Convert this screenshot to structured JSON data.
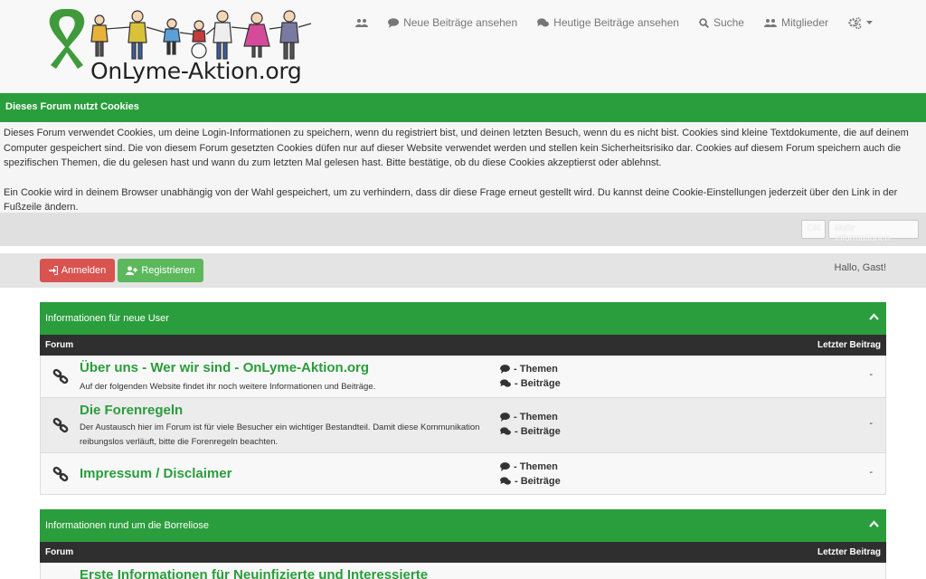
{
  "header": {
    "logo_text": "OnLyme-Aktion.org",
    "nav": [
      {
        "label": "",
        "icon": "users-icon"
      },
      {
        "label": "Neue Beiträge ansehen",
        "icon": "comment-icon"
      },
      {
        "label": "Heutige Beiträge ansehen",
        "icon": "comments-icon"
      },
      {
        "label": "Suche",
        "icon": "search-icon"
      },
      {
        "label": "Mitglieder",
        "icon": "users-icon"
      },
      {
        "label": "",
        "icon": "cogs-icon"
      }
    ]
  },
  "cookie": {
    "title": "Dieses Forum nutzt Cookies",
    "paragraph1": "Dieses Forum verwendet Cookies, um deine Login-Informationen zu speichern, wenn du registriert bist, und deinen letzten Besuch, wenn du es nicht bist. Cookies sind kleine Textdokumente, die auf deinem Computer gespeichert sind. Die von diesem Forum gesetzten Cookies düfen nur auf dieser Website verwendet werden und stellen kein Sicherheitsrisiko dar. Cookies auf diesem Forum speichern auch die spezifischen Themen, die du gelesen hast und wann du zum letzten Mal gelesen hast. Bitte bestätige, ob du diese Cookies akzeptierst oder ablehnst.",
    "paragraph2": "Ein Cookie wird in deinem Browser unabhängig von der Wahl gespeichert, um zu verhindern, dass dir diese Frage erneut gestellt wird. Du kannst deine Cookie-Einstellungen jederzeit über den Link in der Fußzeile ändern.",
    "ok_label": "OK",
    "info_label": "Mehr Informationen"
  },
  "userbar": {
    "login_label": "Anmelden",
    "register_label": "Registrieren",
    "greeting": "Hallo, Gast!"
  },
  "categories": [
    {
      "title": "Informationen für neue User",
      "col_forum": "Forum",
      "col_last": "Letzter Beitrag",
      "forums": [
        {
          "title": "Über uns - Wer wir sind - OnLyme-Aktion.org",
          "desc": "Auf der folgenden Website findet ihr noch weitere Informationen und Beiträge.",
          "threads": "- Themen",
          "posts": "- Beiträge",
          "last": "-"
        },
        {
          "title": "Die Forenregeln",
          "desc": "Der Austausch hier im Forum ist für viele Besucher ein wichtiger Bestandteil. Damit diese Kommunikation reibungslos verläuft, bitte die Forenregeln beachten.",
          "threads": "- Themen",
          "posts": "- Beiträge",
          "last": "-"
        },
        {
          "title": "Impressum / Disclaimer",
          "desc": "",
          "threads": "- Themen",
          "posts": "- Beiträge",
          "last": "-"
        }
      ]
    },
    {
      "title": "Informationen rund um die Borreliose",
      "col_forum": "Forum",
      "col_last": "Letzter Beitrag",
      "forums": [
        {
          "title": "Erste Informationen für Neuinfizierte und Interessierte",
          "desc": "",
          "threads": "",
          "posts": "",
          "last": ""
        }
      ]
    }
  ],
  "colors": {
    "green": "#2a9d3c",
    "dark": "#2f2f2f",
    "red": "#d9534f",
    "register_green": "#5cb85c"
  }
}
